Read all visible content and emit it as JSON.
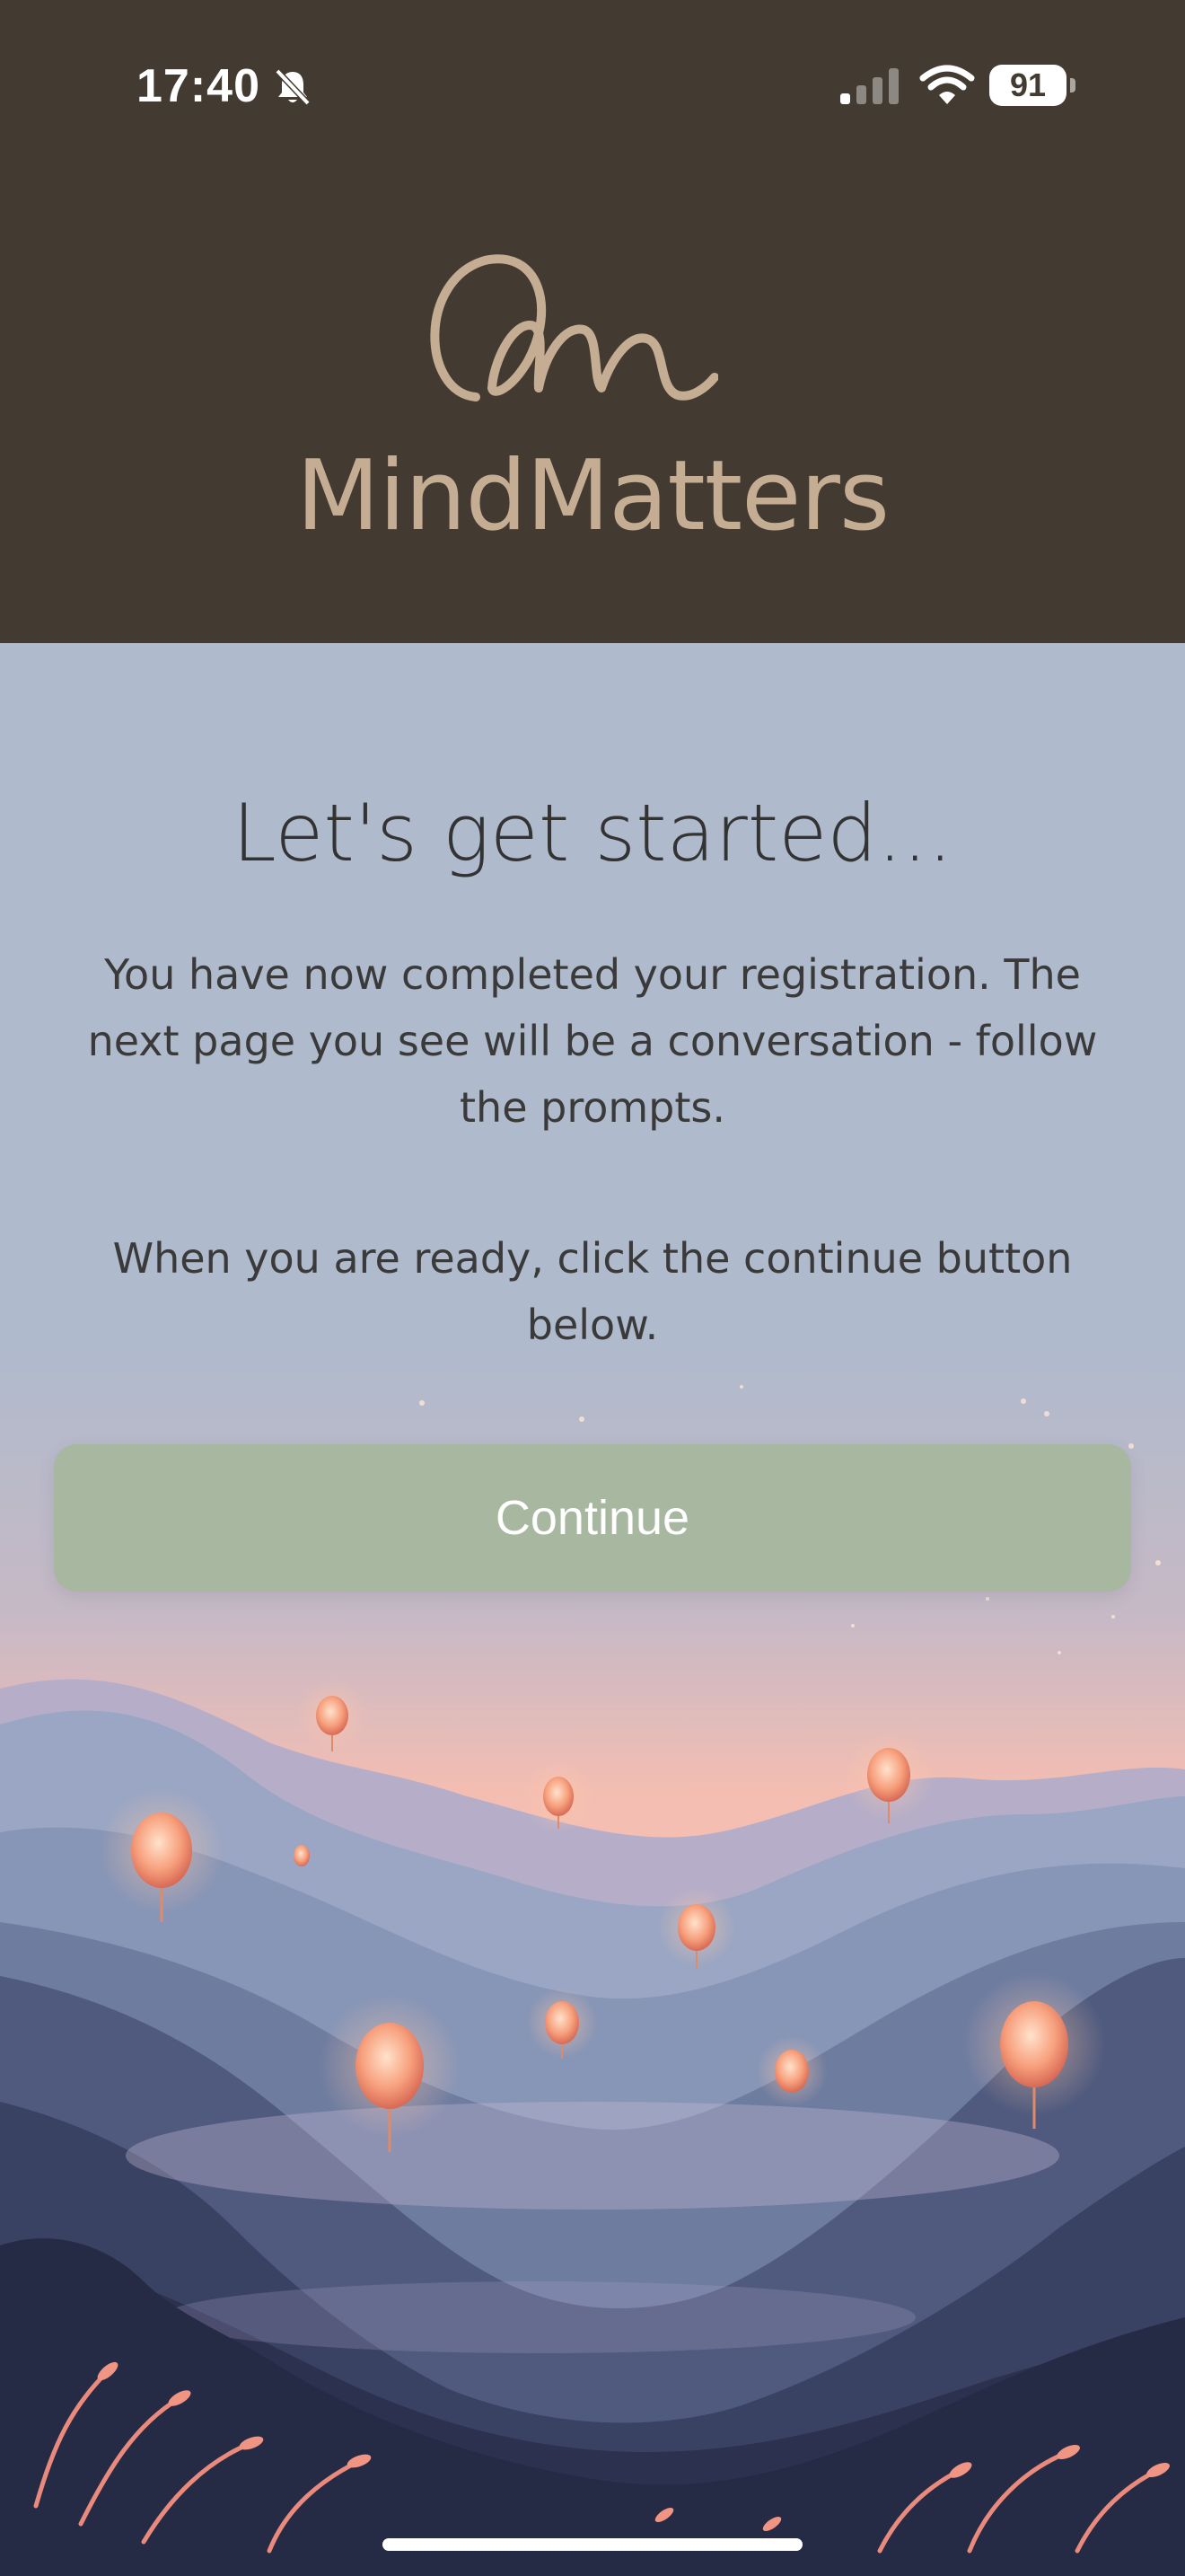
{
  "status_bar": {
    "time": "17:40",
    "battery_level": "91",
    "icons": [
      "bell-slash-icon",
      "cellular-signal-icon",
      "wifi-icon",
      "battery-icon"
    ]
  },
  "header": {
    "brand_name": "MindMatters",
    "logo_icon": "mm-script-logo-icon",
    "background_color": "#433a31",
    "brand_color": "#c4ad93"
  },
  "main": {
    "heading": "Let's get started...",
    "paragraph_1": "You have now completed your registration. The next page you see will be a conversation - follow the prompts.",
    "paragraph_2": "When you are ready, click the continue button below.",
    "background_color": "#afbacc"
  },
  "continue_button": {
    "label": "Continue",
    "color": "#a7b7a0"
  },
  "illustration": {
    "icon": "lantern-mountain-landscape-illustration"
  }
}
